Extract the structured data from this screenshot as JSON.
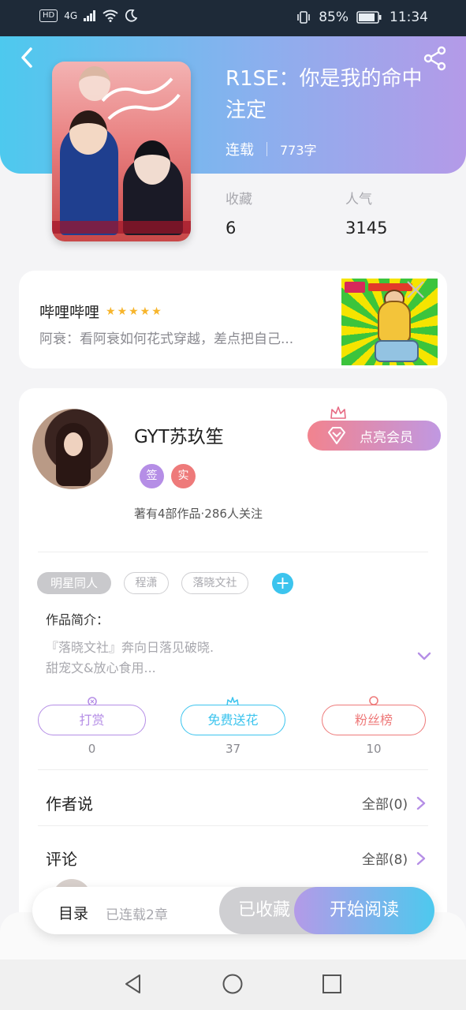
{
  "status_bar": {
    "hd": "HD",
    "network": "4G",
    "battery": "85%",
    "time": "11:34"
  },
  "icons": {
    "back": "chevron-left-icon",
    "share": "share-icon",
    "close": "close-icon",
    "crown": "crown-icon",
    "diamond": "diamond-icon",
    "add": "plus-icon",
    "expand": "chevron-down-icon",
    "more": "chevron-right-icon"
  },
  "book": {
    "title": "R1SE：你是我的命中注定",
    "status": "连载",
    "word_count": "773字",
    "stats": [
      {
        "label": "收藏",
        "value": "6"
      },
      {
        "label": "人气",
        "value": "3145"
      }
    ]
  },
  "ad": {
    "title": "哔哩哔哩",
    "stars": "★★★★★",
    "description": "阿衰：看阿衰如何花式穿越，差点把自己..."
  },
  "author": {
    "name": "GYT苏玖笙",
    "badges": [
      "签",
      "实"
    ],
    "stats": "著有4部作品·286人关注",
    "vip_button": "点亮会员"
  },
  "tags": {
    "active": "明星同人",
    "items": [
      "程潇",
      "落晓文社"
    ],
    "add": "+"
  },
  "intro": {
    "label": "作品简介：",
    "lines": [
      "『落晓文社』奔向日落见破晓.",
      "甜宠文&放心食用..."
    ]
  },
  "actions": [
    {
      "label": "打赏",
      "count": "0",
      "color": "#b58ee6"
    },
    {
      "label": "免费送花",
      "count": "37",
      "color": "#3cc4ee"
    },
    {
      "label": "粉丝榜",
      "count": "10",
      "color": "#ee7a7a"
    }
  ],
  "sections": {
    "author_says": {
      "title": "作者说",
      "more": "全部(0)"
    },
    "comments": {
      "title": "评论",
      "more": "全部(8)"
    }
  },
  "bottom_bar": {
    "toc": "目录",
    "chapters": "已连载2章",
    "favorited": "已收藏",
    "read": "开始阅读"
  },
  "colors": {
    "header_start": "#4dc9ee",
    "header_end": "#b49ae8",
    "accent_purple": "#b58ee6",
    "accent_cyan": "#3cc4ee",
    "accent_red": "#ee7a7a",
    "badge_sign": "#b58ee6",
    "badge_real": "#ee7a7a"
  }
}
